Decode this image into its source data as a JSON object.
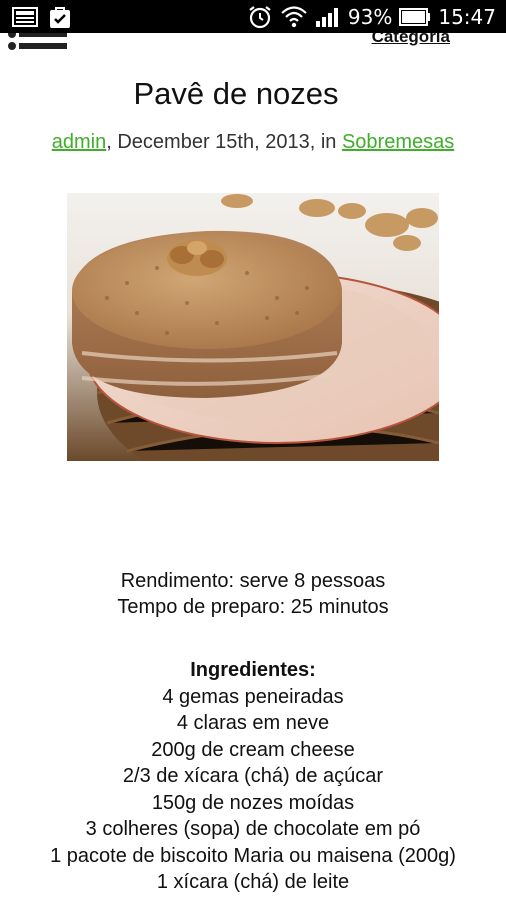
{
  "status_bar": {
    "battery_percent": "93%",
    "time": "15:47",
    "icons": [
      "gallery-icon",
      "shopping-bag-check-icon",
      "alarm-icon",
      "wifi-icon",
      "signal-icon",
      "battery-icon"
    ]
  },
  "header": {
    "menu_icon": "list-menu-icon",
    "category_label": "Categoria"
  },
  "post": {
    "title": "Pavê de nozes",
    "author": "admin",
    "date_text": ", December 15th, 2013, in ",
    "category": "Sobremesas",
    "image_alt_icon": "cake-photo"
  },
  "recipe": {
    "yield": "Rendimento: serve 8 pessoas",
    "prep_time": "Tempo de preparo: 25 minutos",
    "ingredients_heading": "Ingredientes:",
    "ingredients": [
      "4 gemas peneiradas",
      "4 claras em neve",
      "200g de cream cheese",
      "2/3 de xícara (chá) de açúcar",
      "150g de nozes moídas",
      "3 colheres (sopa) de chocolate em pó",
      "1 pacote de biscoito Maria ou maisena (200g)",
      "1 xícara (chá) de leite"
    ]
  },
  "colors": {
    "link_green": "#3fae29",
    "statusbar_bg": "#000000"
  }
}
